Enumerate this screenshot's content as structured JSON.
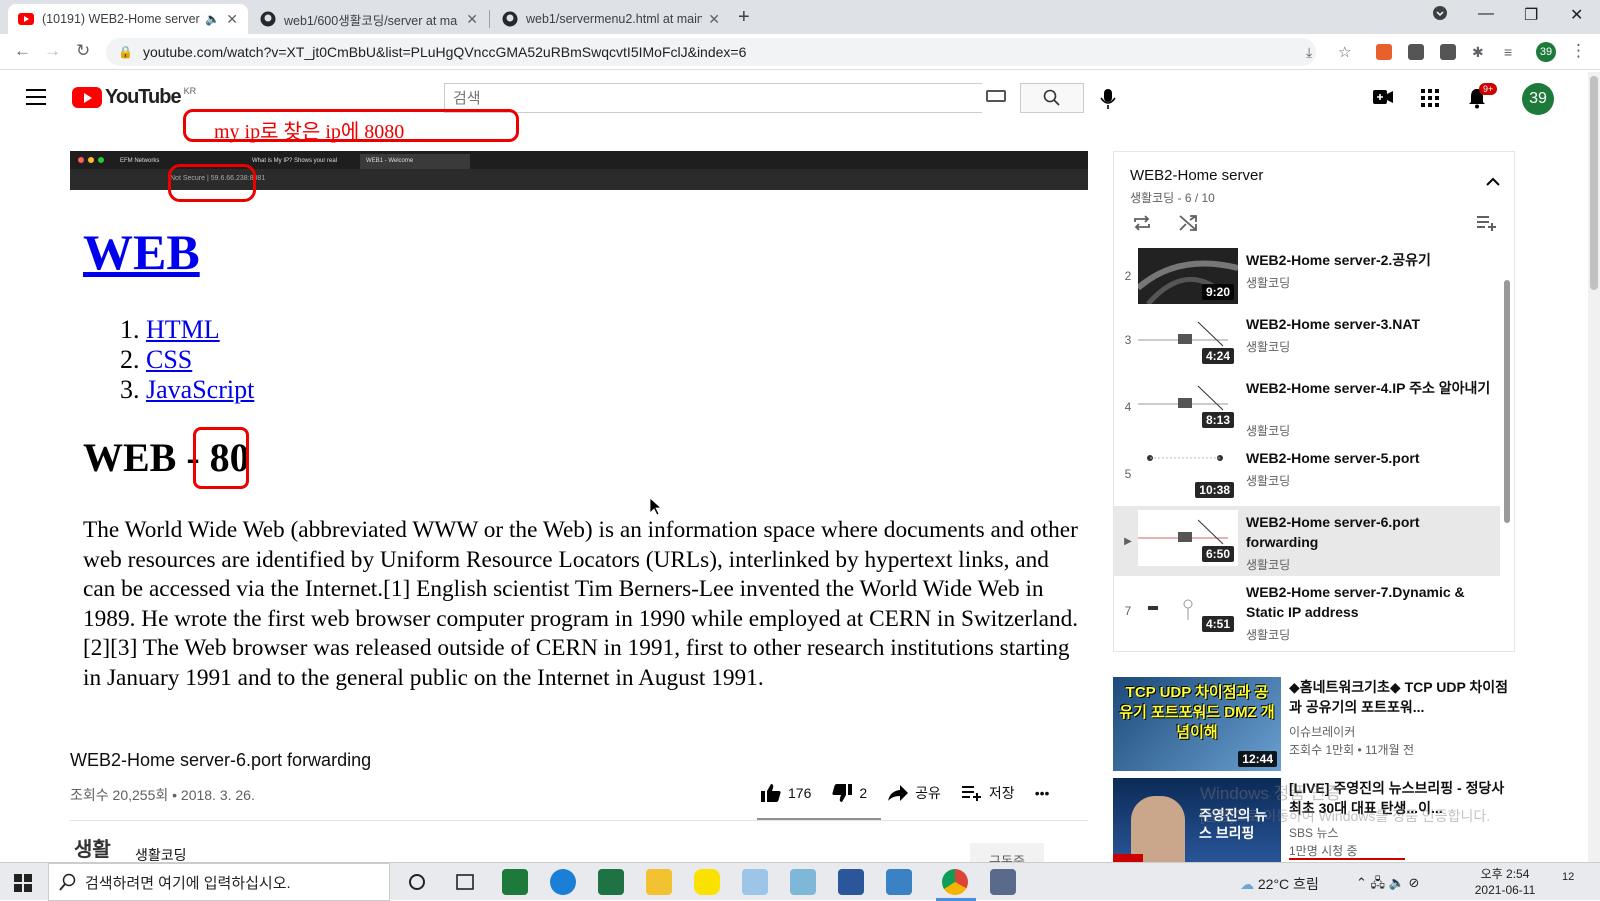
{
  "browser": {
    "tabs": [
      {
        "title": "(10191) WEB2-Home server",
        "icon": "youtube-icon"
      },
      {
        "title": "web1/600생활코딩/server at ma",
        "icon": "github-icon"
      },
      {
        "title": "web1/servermenu2.html at main",
        "icon": "github-icon"
      }
    ],
    "url": "youtube.com/watch?v=XT_jt0CmBbU&list=PLuHgQVnccGMA52uRBmSwqcvtI5IMoFclJ&index=6",
    "profile_badge": "39"
  },
  "youtube": {
    "logo_text": "YouTube",
    "country": "KR",
    "search_placeholder": "검색",
    "notification_count": "9+",
    "avatar_text": "39"
  },
  "annotation": "my ip로 찾은 ip에 8080",
  "video": {
    "inner_tabs": [
      "EFM Networks",
      "What is My IP? Shows your real",
      "WEB1 - Welcome"
    ],
    "inner_url": "Not Secure | 59.6.66.238:8081",
    "heading": "WEB",
    "list": [
      {
        "num": "1.",
        "label": "HTML"
      },
      {
        "num": "2.",
        "label": "CSS"
      },
      {
        "num": "3.",
        "label": "JavaScript"
      }
    ],
    "subheading": "WEB - 80",
    "paragraph": "The World Wide Web (abbreviated WWW or the Web) is an information space where documents and other web resources are identified by Uniform Resource Locators (URLs), interlinked by hypertext links, and can be accessed via the Internet.[1] English scientist Tim Berners-Lee invented the World Wide Web in 1989. He wrote the first web browser computer program in 1990 while employed at CERN in Switzerland.[2][3] The Web browser was released outside of CERN in 1991, first to other research institutions starting in January 1991 and to the general public on the Internet in August 1991."
  },
  "video_info": {
    "title": "WEB2-Home server-6.port forwarding",
    "views_date": "조회수 20,255회 • 2018. 3. 26.",
    "likes": "176",
    "dislikes": "2",
    "share": "공유",
    "save": "저장",
    "more": "•••",
    "channel_logo": "생활",
    "channel": "생활코딩",
    "subscribe": "구독중"
  },
  "playlist": {
    "title": "WEB2-Home server",
    "subtitle": "생활코딩 - 6 / 10",
    "items": [
      {
        "index": "2",
        "title": "WEB2-Home server-2.공유기",
        "channel": "생활코딩",
        "duration": "9:20"
      },
      {
        "index": "3",
        "title": "WEB2-Home server-3.NAT",
        "channel": "생활코딩",
        "duration": "4:24"
      },
      {
        "index": "4",
        "title": "WEB2-Home server-4.IP 주소 알아내기",
        "channel": "생활코딩",
        "duration": "8:13"
      },
      {
        "index": "5",
        "title": "WEB2-Home server-5.port",
        "channel": "생활코딩",
        "duration": "10:38"
      },
      {
        "index": "▶",
        "title": "WEB2-Home server-6.port forwarding",
        "channel": "생활코딩",
        "duration": "6:50"
      },
      {
        "index": "7",
        "title": "WEB2-Home server-7.Dynamic & Static IP address",
        "channel": "생활코딩",
        "duration": "4:51"
      }
    ]
  },
  "recommendations": [
    {
      "title": "◆홈네트워크기초◆ TCP UDP 차이점과 공유기의 포트포워...",
      "channel": "이슈브레이커",
      "meta": "조회수 1만회 • 11개월 전",
      "duration": "12:44",
      "thumb_text": "TCP UDP 차이점과 공유기 포트포워드 DMZ 개념이해"
    },
    {
      "title": "[LIVE] 주영진의 뉴스브리핑 - 정당사 최초 30대 대표 탄생...이...",
      "channel": "SBS 뉴스",
      "meta": "1만명 시청 중",
      "duration": "",
      "thumb_text": "주영진의 뉴스 브리핑"
    }
  ],
  "watermark": [
    "Windows 정품 인증",
    "[설정]으로 이동하여 Windows를 정품 인증합니다."
  ],
  "taskbar": {
    "search_placeholder": "검색하려면 여기에 입력하십시오.",
    "weather": "22°C 흐림",
    "time": "오후 2:54",
    "date": "2021-06-11",
    "notif_count": "12"
  },
  "colors": {
    "youtube_red": "#ff0000",
    "annotation_red": "#ee0000",
    "link_blue": "#0000ee"
  }
}
